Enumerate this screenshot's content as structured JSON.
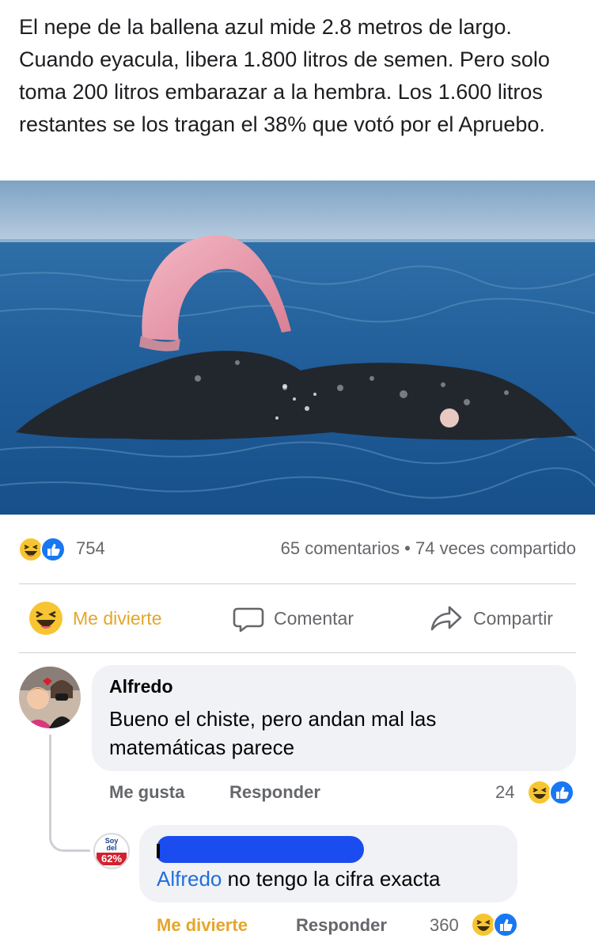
{
  "post": {
    "text": "El nepe de la ballena azul mide 2.8 metros de largo. Cuando eyacula, libera 1.800 litros de semen. Pero solo toma 200 litros embarazar a la hembra. Los 1.600 litros restantes se los tragan el 38% que votó por el Apruebo."
  },
  "stats": {
    "reaction_icons": [
      "haha-icon",
      "like-icon"
    ],
    "reaction_count": "754",
    "comments": "65 comentarios",
    "separator": "•",
    "shares": "74 veces compartido"
  },
  "actions": {
    "react_label": "Me divierte",
    "comment_label": "Comentar",
    "share_label": "Compartir"
  },
  "comments": [
    {
      "author": "Alfredo",
      "text": "Bueno el chiste, pero andan mal las matemáticas parece",
      "like_label": "Me gusta",
      "reply_label": "Responder",
      "reaction_count": "24"
    }
  ],
  "reply": {
    "badge": {
      "line1": "Soy",
      "line2": "del",
      "line3": "62%"
    },
    "mention": "Alfredo",
    "text": " no tengo la cifra exacta",
    "react_label": "Me divierte",
    "reply_label": "Responder",
    "reaction_count": "360"
  },
  "colors": {
    "accent_haha": "#e5a62b",
    "like_blue": "#1877f2",
    "mention_blue": "#216fdb",
    "redaction_blue": "#1a4cf0",
    "meta_gray": "#65676b"
  }
}
